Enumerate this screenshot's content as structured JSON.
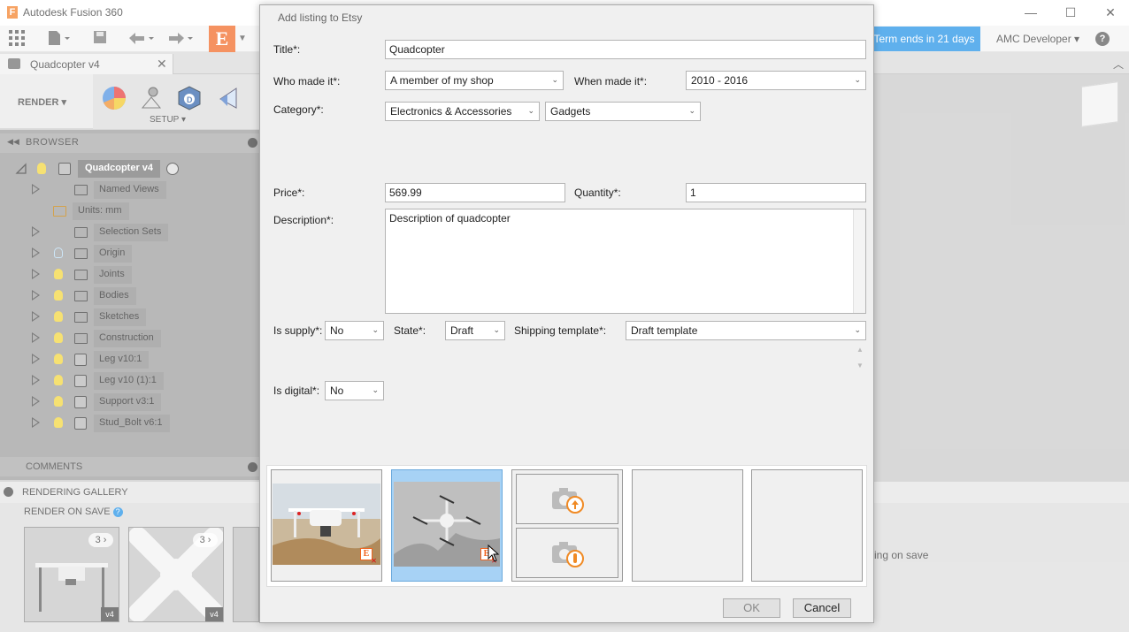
{
  "app": {
    "title": "Autodesk Fusion 360",
    "logo_letter": "F"
  },
  "window": {
    "minimize": "—",
    "maximize": "☐",
    "close": "✕"
  },
  "toolbar": {
    "etsy_letter": "E",
    "term_text": "Term ends in 21 days",
    "account": "AMC Developer ▾",
    "help": "?"
  },
  "doc_tab": {
    "label": "Quadcopter v4",
    "close": "✕"
  },
  "ribbon": {
    "workspace": "RENDER ▾",
    "group_label": "SETUP ▾"
  },
  "browser": {
    "title": "BROWSER",
    "root": "Quadcopter v4",
    "items": [
      {
        "label": "Named Views",
        "icon": "folder-icon",
        "bulb": "none",
        "arrow": true
      },
      {
        "label": "Units: mm",
        "icon": "units-icon",
        "bulb": "none",
        "arrow": false
      },
      {
        "label": "Selection Sets",
        "icon": "folder-icon",
        "bulb": "none",
        "arrow": true
      },
      {
        "label": "Origin",
        "icon": "folder-icon",
        "bulb": "off",
        "arrow": true
      },
      {
        "label": "Joints",
        "icon": "folder-icon",
        "bulb": "on",
        "arrow": true
      },
      {
        "label": "Bodies",
        "icon": "folder-icon",
        "bulb": "on",
        "arrow": true
      },
      {
        "label": "Sketches",
        "icon": "folder-icon",
        "bulb": "on",
        "arrow": true
      },
      {
        "label": "Construction",
        "icon": "folder-icon",
        "bulb": "on",
        "arrow": true
      },
      {
        "label": "Leg v10:1",
        "icon": "component-icon",
        "bulb": "on",
        "arrow": true
      },
      {
        "label": "Leg v10 (1):1",
        "icon": "component-icon",
        "bulb": "on",
        "arrow": true
      },
      {
        "label": "Support v3:1",
        "icon": "component-icon",
        "bulb": "on",
        "arrow": true
      },
      {
        "label": "Stud_Bolt v6:1",
        "icon": "component-icon",
        "bulb": "on",
        "arrow": true
      }
    ]
  },
  "comments": {
    "title": "COMMENTS"
  },
  "gallery": {
    "title": "RENDERING GALLERY",
    "render_on_save": "RENDER ON SAVE",
    "render_on_save_help": "?",
    "thumbs": [
      {
        "count": "3 ›",
        "version": "v4"
      },
      {
        "count": "3 ›",
        "version": "v4"
      }
    ],
    "right_text": "ing on save"
  },
  "dialog": {
    "title": "Add listing to Etsy",
    "title_label": "Title*:",
    "title_value": "Quadcopter",
    "who_label": "Who made it*:",
    "who_value": "A member of my shop",
    "when_label": "When made it*:",
    "when_value": "2010 - 2016",
    "category_label": "Category*:",
    "category_value": "Electronics & Accessories",
    "subcategory_value": "Gadgets",
    "price_label": "Price*:",
    "price_value": "569.99",
    "quantity_label": "Quantity*:",
    "quantity_value": "1",
    "description_label": "Description*:",
    "description_value": "Description of quadcopter",
    "supply_label": "Is supply*:",
    "supply_value": "No",
    "state_label": "State*:",
    "state_value": "Draft",
    "shipping_label": "Shipping template*:",
    "shipping_value": "Draft template",
    "digital_label": "Is digital*:",
    "digital_value": "No",
    "ok": "OK",
    "cancel": "Cancel",
    "caret": "⌄"
  },
  "colors": {
    "etsy_orange": "#f1641e",
    "accent_blue": "#1a8ee6",
    "selected_slot": "#a7d2f5"
  }
}
